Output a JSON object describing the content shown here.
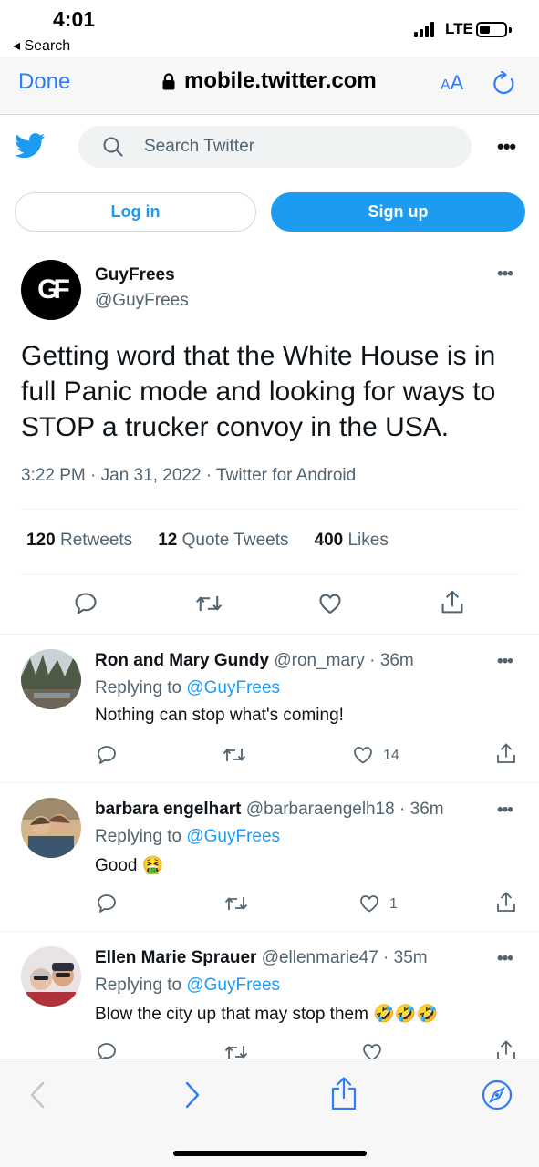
{
  "status_bar": {
    "time": "4:01",
    "back_label": "◂ Search",
    "network": "LTE"
  },
  "browser": {
    "done_label": "Done",
    "url": "mobile.twitter.com",
    "text_size_label_small": "A",
    "text_size_label_large": "A"
  },
  "twitter_bar": {
    "search_placeholder": "Search Twitter",
    "more_label": "•••"
  },
  "auth": {
    "login_label": "Log in",
    "signup_label": "Sign up"
  },
  "tweet": {
    "avatar_letters": "GF",
    "author_name": "GuyFrees",
    "author_handle": "@GuyFrees",
    "more_label": "•••",
    "text": "Getting word that the White House is in full Panic mode and looking for ways to STOP a trucker convoy in the USA.",
    "meta": "3:22 PM · Jan 31, 2022 · Twitter for Android",
    "stats": [
      {
        "count": "120",
        "label": "Retweets"
      },
      {
        "count": "12",
        "label": "Quote Tweets"
      },
      {
        "count": "400",
        "label": "Likes"
      }
    ]
  },
  "replies": [
    {
      "name": "Ron and Mary Gundy",
      "handle_time": "@ron_mary · 36m",
      "replying_prefix": "Replying to ",
      "replying_to": "@GuyFrees",
      "text": "Nothing can stop what's coming!",
      "like_count": "14",
      "more_label": "•••"
    },
    {
      "name": "barbara engelhart",
      "handle_time": "@barbaraengelh18 · 36m",
      "replying_prefix": "Replying to ",
      "replying_to": "@GuyFrees",
      "text": "Good 🤮",
      "like_count": "1",
      "more_label": "•••"
    },
    {
      "name": "Ellen Marie Sprauer",
      "handle_time": "@ellenmarie47 · 35m",
      "replying_prefix": "Replying to ",
      "replying_to": "@GuyFrees",
      "text": "Blow the city up that may stop them 🤣🤣🤣",
      "like_count": "",
      "more_label": "•••"
    }
  ],
  "icons": {
    "bird": "twitter-bird-icon",
    "search": "search-icon",
    "reply": "reply-icon",
    "retweet": "retweet-icon",
    "like": "like-icon",
    "share": "share-icon",
    "back": "chevron-left-icon",
    "forward": "chevron-right-icon",
    "compass": "compass-icon",
    "lock": "lock-icon",
    "reload": "reload-icon"
  },
  "colors": {
    "twitter_blue": "#1d9bf0",
    "ios_blue": "#2f7df6",
    "secondary_text": "#536471"
  }
}
